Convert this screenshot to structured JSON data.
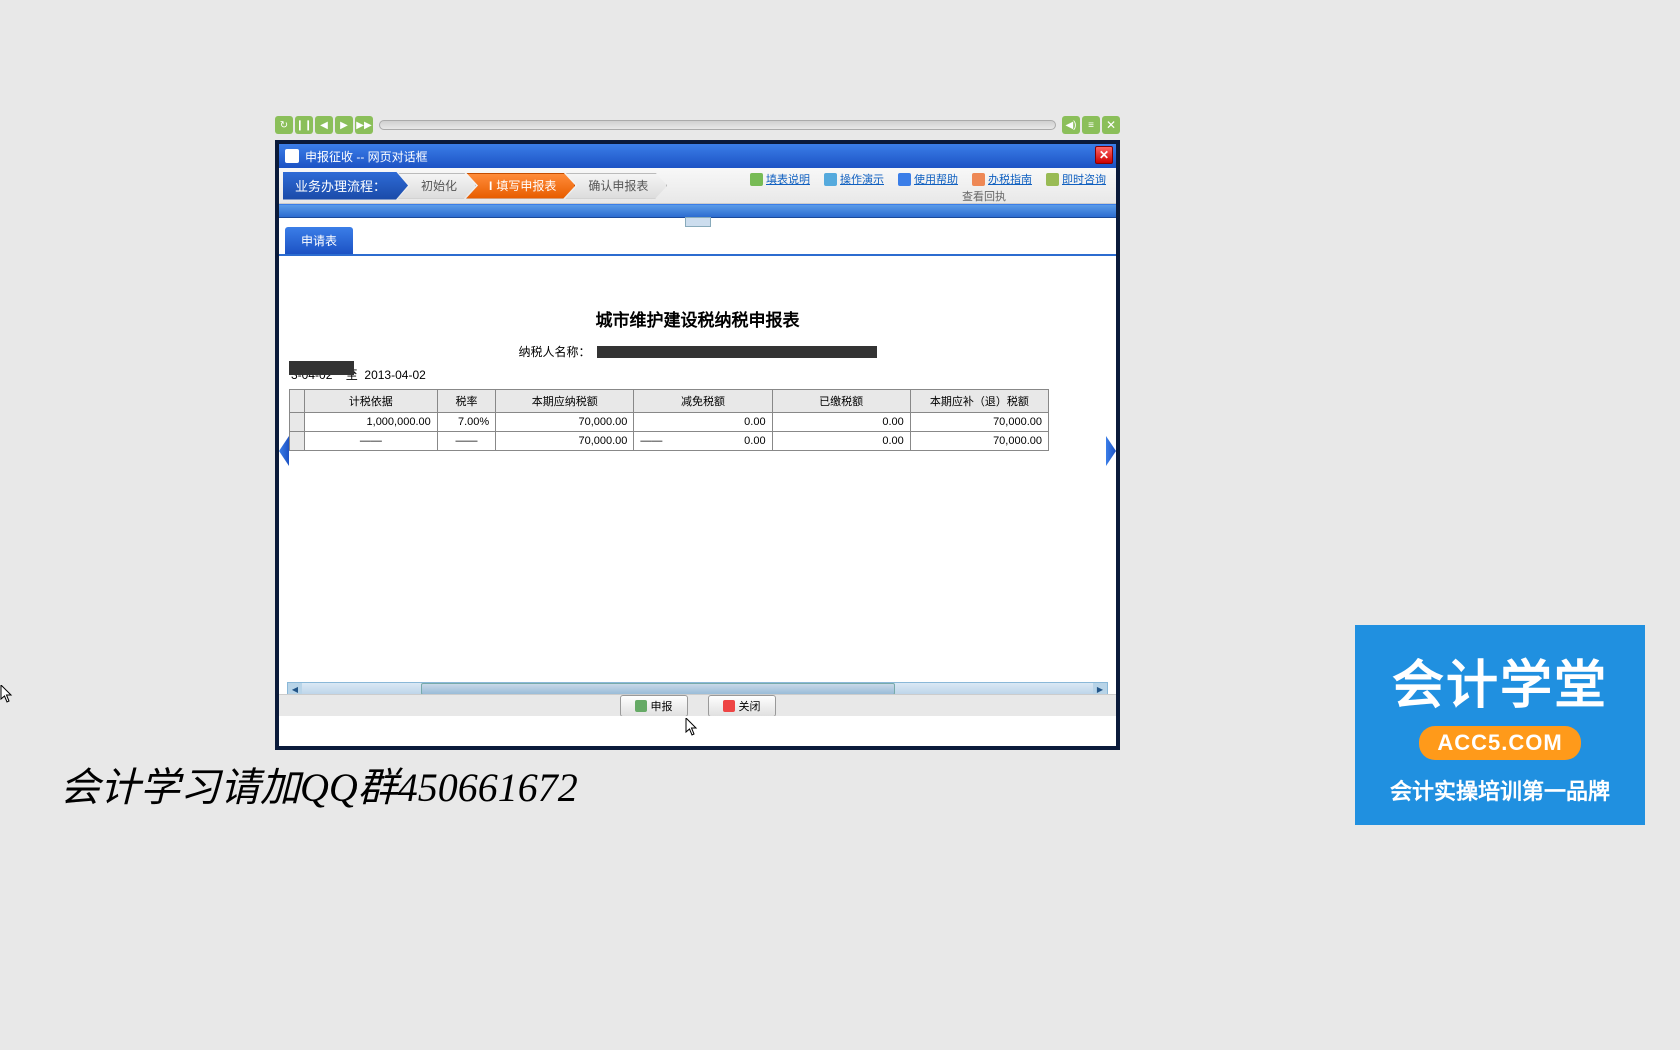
{
  "player": {
    "btn_restart": "↻",
    "btn_pause": "❙❙",
    "btn_prev": "◀",
    "btn_next": "▶",
    "btn_ff": "▶▶",
    "btn_sound": "◀)",
    "btn_menu": "≡",
    "btn_close": "✕"
  },
  "window": {
    "title": "申报征收 -- 网页对话框",
    "close": "✕"
  },
  "process": {
    "label": "业务办理流程：",
    "steps": {
      "s1": "初始化",
      "s2_no": "I",
      "s2": "填写申报表",
      "s3": "确认申报表",
      "s4": "查看回执"
    }
  },
  "toolbar_links": {
    "a": "填表说明",
    "b": "操作演示",
    "c": "使用帮助",
    "d": "办税指南",
    "e": "即时咨询"
  },
  "tab": {
    "active": "申请表"
  },
  "doc": {
    "title": "城市维护建设税纳税申报表",
    "name_label": "纳税人名称：",
    "date_prefix": "3-04-02",
    "date_sep": "至",
    "date_end": "2013-04-02"
  },
  "table": {
    "headers": {
      "c1": "计税依据",
      "c2": "税率",
      "c3": "本期应纳税额",
      "c4": "减免税额",
      "c5": "已缴税额",
      "c6": "本期应补（退）税额"
    },
    "row1": {
      "c1": "1,000,000.00",
      "c2": "7.00%",
      "c3": "70,000.00",
      "c4": "0.00",
      "c5": "0.00",
      "c6": "70,000.00"
    },
    "row2": {
      "c1": "——",
      "c2": "——",
      "c3": "70,000.00",
      "c4_dash": "——",
      "c4": "0.00",
      "c5": "0.00",
      "c6": "70,000.00"
    }
  },
  "buttons": {
    "submit": "申报",
    "close": "关闭"
  },
  "watermark": {
    "text": "会计学习请加QQ群450661672",
    "logo_title": "会计学堂",
    "logo_url": "ACC5.COM",
    "logo_sub": "会计实操培训第一品牌"
  }
}
